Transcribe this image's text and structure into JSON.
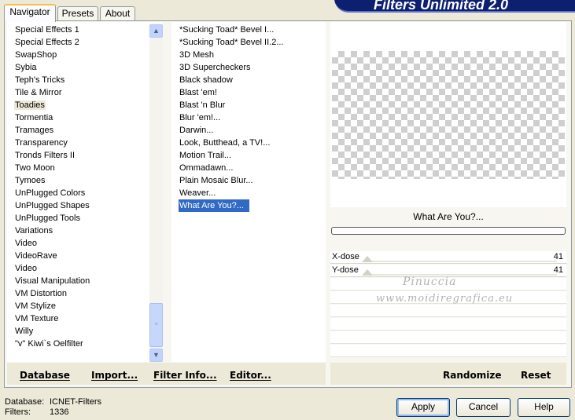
{
  "tabs": [
    {
      "label": "Navigator"
    },
    {
      "label": "Presets"
    },
    {
      "label": "About"
    }
  ],
  "title": "Filters Unlimited 2.0",
  "categories": {
    "items": [
      "Special Effects 1",
      "Special Effects 2",
      "SwapShop",
      "Sybia",
      "Teph's Tricks",
      "Tile & Mirror",
      "Toadies",
      "Tormentia",
      "Tramages",
      "Transparency",
      "Tronds Filters II",
      "Two Moon",
      "Tymoes",
      "UnPlugged Colors",
      "UnPlugged Shapes",
      "UnPlugged Tools",
      "Variations",
      "Video",
      "VideoRave",
      "Video",
      "Visual Manipulation",
      "VM Distortion",
      "VM Stylize",
      "VM Texture",
      "Willy",
      "\"v\" Kiwi`s Oelfilter"
    ],
    "selected": "Toadies"
  },
  "filters": {
    "items": [
      "*Sucking Toad*  Bevel I...",
      "*Sucking Toad*  Bevel II.2...",
      "3D Mesh",
      "3D Supercheckers",
      "Black shadow",
      "Blast 'em!",
      "Blast 'n Blur",
      "Blur 'em!...",
      "Darwin...",
      "Look, Butthead, a TV!...",
      "Motion Trail...",
      "Ommadawn...",
      "Plain Mosaic Blur...",
      "Weaver...",
      "What Are You?..."
    ],
    "selected": "What Are You?..."
  },
  "preview": {
    "filter_name": "What Are You?..."
  },
  "params": [
    {
      "label": "X-dose",
      "value": "41"
    },
    {
      "label": "Y-dose",
      "value": "41"
    }
  ],
  "watermark": {
    "line1": "Pinuccia",
    "line2": "www.moidiregrafica.eu"
  },
  "panel_buttons": {
    "database": "Database",
    "import": "Import...",
    "filter_info": "Filter Info...",
    "editor": "Editor...",
    "randomize": "Randomize",
    "reset": "Reset"
  },
  "status": {
    "database_label": "Database:",
    "database_value": "ICNET-Filters",
    "filters_label": "Filters:",
    "filters_value": "1336"
  },
  "dialog_buttons": {
    "apply": "Apply",
    "cancel": "Cancel",
    "help": "Help"
  }
}
